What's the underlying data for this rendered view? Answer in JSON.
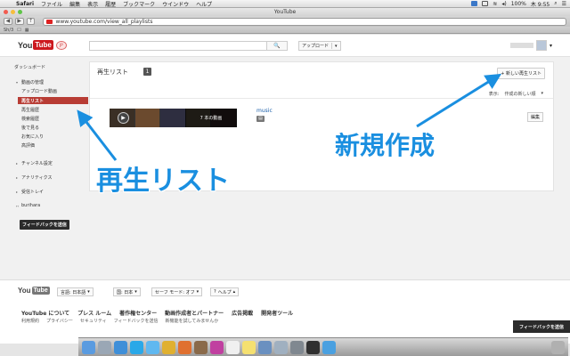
{
  "os_menubar": {
    "app": "Safari",
    "items": [
      "ファイル",
      "編集",
      "表示",
      "履歴",
      "ブックマーク",
      "ウインドウ",
      "ヘルプ"
    ],
    "battery": "100%",
    "clock": "木 9:55"
  },
  "browser": {
    "window_title": "YouTube",
    "url": "www.youtube.com/view_all_playlists",
    "bookmark": "Sh/3"
  },
  "header": {
    "logo_you": "You",
    "logo_tube": "Tube",
    "logo_region": "JP",
    "search_button": "🔍",
    "upload_label": "アップロード"
  },
  "sidebar": {
    "dashboard": "ダッシュボード",
    "video_manager": "動画の管理",
    "uploads": "アップロード動画",
    "playlists": "再生リスト",
    "history": "再生履歴",
    "search_history": "検索履歴",
    "watch_later": "後で見る",
    "favorites": "お気に入り",
    "likes": "高評価",
    "channel_settings": "チャンネル設定",
    "analytics": "アナリティクス",
    "inbox": "受信トレイ",
    "username": "burihara",
    "feedback": "フィードバックを送信"
  },
  "main": {
    "title": "再生リスト",
    "count": "1",
    "new_playlist": "+ 新しい再生リスト",
    "sort_label": "表示:",
    "sort_value": "作成の新しい順",
    "playlist": {
      "video_count": "7 本の動画",
      "title": "music",
      "edit": "編集"
    }
  },
  "annotations": {
    "left": "再生リスト",
    "right": "新規作成"
  },
  "footer": {
    "logo_you": "You",
    "logo_tube": "Tube",
    "language": "言語: 日本語",
    "country": "国: 日本",
    "safety": "セーフ モード: オフ",
    "help": "ヘルプ",
    "links": [
      "YouTube について",
      "プレス ルーム",
      "著作権センター",
      "動画作成者とパートナー",
      "広告掲載",
      "開発者ツール"
    ],
    "links2": [
      "利用規約",
      "プライバシー",
      "セキュリティ",
      "フィードバックを送信",
      "新機能を試してみませんか"
    ],
    "feedback_corner": "フィードバックを送信"
  },
  "colors": {
    "youtube_red": "#cc181e",
    "sidebar_active": "#b83c34",
    "annotation_blue": "#1a8fe0",
    "link_blue": "#1b5faa"
  },
  "dock_icons": [
    "finder",
    "launchpad",
    "safari",
    "skype",
    "twitter",
    "chrome",
    "firefox",
    "photos",
    "itunes",
    "calendar",
    "notes",
    "mail",
    "preview",
    "settings",
    "terminal",
    "app-store",
    "trash"
  ]
}
